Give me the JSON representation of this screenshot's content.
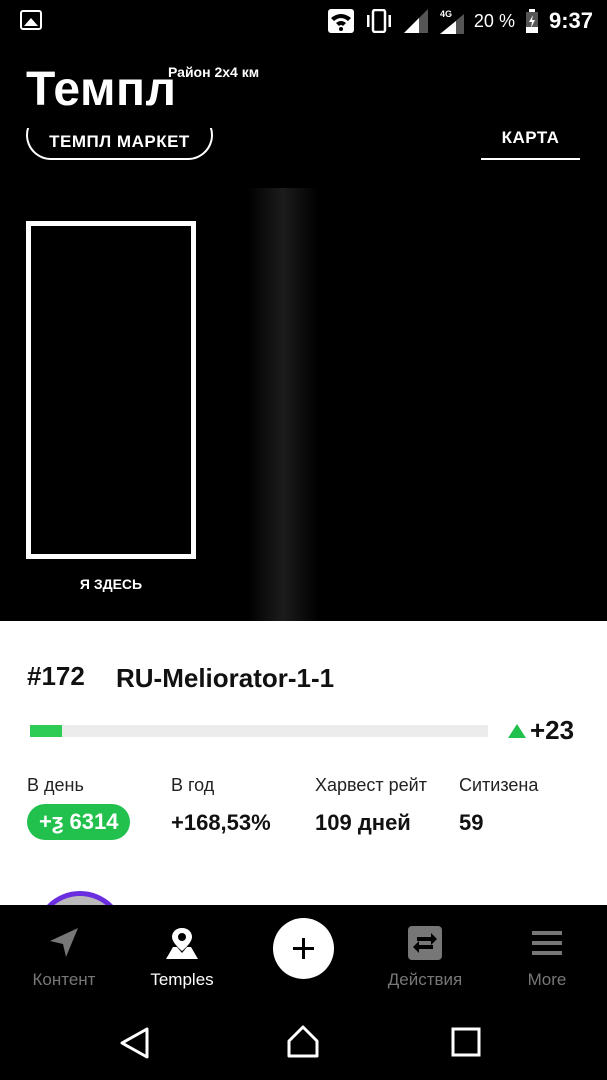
{
  "status_bar": {
    "battery_text": "20 %",
    "time": "9:37",
    "network": "4G"
  },
  "header": {
    "title": "Темпл",
    "district": "Район 2х4 км",
    "market_button": "ТЕМПЛ МАРКЕТ",
    "map_tab": "КАРТА"
  },
  "map": {
    "here_label": "Я ЗДЕСЬ"
  },
  "plot": {
    "number": "#172",
    "name": "RU-Meliorator-1-1",
    "progress": 0.07,
    "delta": "+23",
    "stats": [
      {
        "label": "В день",
        "value": "+ƺ 6314"
      },
      {
        "label": "В год",
        "value": "+168,53%"
      },
      {
        "label": "Харвест рейт",
        "value": "109 дней"
      },
      {
        "label": "Ситизена",
        "value": "59"
      }
    ]
  },
  "bottom_nav": {
    "items": [
      {
        "label": "Контент",
        "icon": "navigation-arrow-icon",
        "active": false
      },
      {
        "label": "Temples",
        "icon": "map-pin-icon",
        "active": true
      },
      {
        "label": "",
        "icon": "plus-icon",
        "active": false
      },
      {
        "label": "Действия",
        "icon": "swap-icon",
        "active": false
      },
      {
        "label": "More",
        "icon": "menu-icon",
        "active": false
      }
    ]
  },
  "colors": {
    "accent_green": "#22c04d",
    "progress_green": "#2ecc55",
    "avatar_ring": "#6a2ee0"
  }
}
